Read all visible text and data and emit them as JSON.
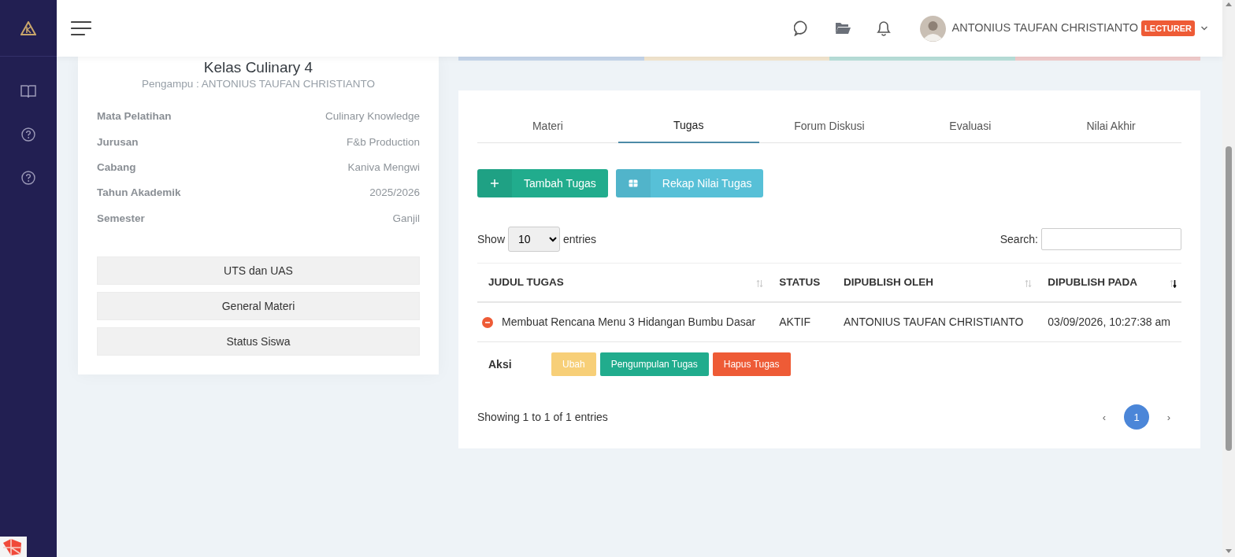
{
  "topbar": {
    "user_name": "ANTONIUS TAUFAN CHRISTIANTO",
    "role_badge": "LECTURER"
  },
  "class_card": {
    "title": "Kelas Culinary 4",
    "subtitle": "Pengampu : ANTONIUS TAUFAN CHRISTIANTO",
    "details": [
      {
        "label": "Mata Pelatihan",
        "value": "Culinary Knowledge"
      },
      {
        "label": "Jurusan",
        "value": "F&b Production"
      },
      {
        "label": "Cabang",
        "value": "Kaniva Mengwi"
      },
      {
        "label": "Tahun Akademik",
        "value": "2025/2026"
      },
      {
        "label": "Semester",
        "value": "Ganjil"
      }
    ],
    "buttons": [
      "UTS dan UAS",
      "General Materi",
      "Status Siswa"
    ]
  },
  "progress_strip": [
    {
      "color": "#c5d5ea"
    },
    {
      "color": "#f3e6cf"
    },
    {
      "color": "#b9e0da"
    },
    {
      "color": "#f1cccc"
    }
  ],
  "tabs": [
    {
      "label": "Materi",
      "selected": false
    },
    {
      "label": "Tugas",
      "selected": true
    },
    {
      "label": "Forum Diskusi",
      "selected": false
    },
    {
      "label": "Evaluasi",
      "selected": false
    },
    {
      "label": "Nilai Akhir",
      "selected": false
    }
  ],
  "actions": [
    {
      "kind": "add",
      "label": "Tambah Tugas"
    },
    {
      "kind": "table",
      "label": "Rekap Nilai Tugas"
    }
  ],
  "table_controls": {
    "show_label": "Show",
    "page_size": "10",
    "entries_label": "entries",
    "search_label": "Search:"
  },
  "table": {
    "columns": [
      {
        "label": "JUDUL TUGAS",
        "sortable": true,
        "sorted_desc": false
      },
      {
        "label": "STATUS",
        "sortable": false,
        "sorted_desc": false
      },
      {
        "label": "DIPUBLISH OLEH",
        "sortable": true,
        "sorted_desc": false
      },
      {
        "label": "DIPUBLISH PADA",
        "sortable": true,
        "sorted_desc": true
      }
    ],
    "rows": [
      {
        "cells": [
          "Membuat Rencana Menu 3 Hidangan Bumbu Dasar",
          "AKTIF",
          "ANTONIUS TAUFAN CHRISTIANTO",
          "03/09/2026, 10:27:38 am"
        ],
        "expanded": true,
        "detail": {
          "label": "Aksi",
          "buttons": [
            {
              "kind": "edit",
              "label": "Ubah"
            },
            {
              "kind": "submissions",
              "label": "Pengumpulan Tugas"
            },
            {
              "kind": "delete",
              "label": "Hapus Tugas"
            }
          ]
        }
      }
    ]
  },
  "footer": {
    "info": "Showing 1 to 1 of 1 entries",
    "prev": "‹",
    "next": "›",
    "pages": [
      {
        "label": "1",
        "selected": true
      }
    ]
  }
}
